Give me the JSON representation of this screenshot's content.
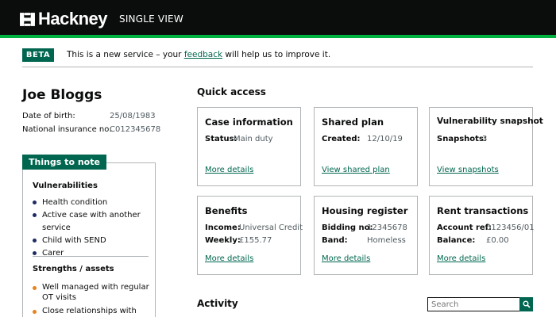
{
  "header": {
    "logo_text": "Hackney",
    "service_name": "SINGLE VIEW"
  },
  "beta_banner": {
    "tag": "BETA",
    "text_before": "This is a new service – your ",
    "link_text": "feedback",
    "text_after": " will help us to improve it."
  },
  "person": {
    "name": "Joe Bloggs",
    "details": [
      {
        "label": "Date of birth:",
        "value": "25/08/1983"
      },
      {
        "label": "National insurance no:",
        "value": "C012345678"
      }
    ]
  },
  "things_to_note": {
    "title": "Things to note",
    "vulnerabilities_heading": "Vulnerabilities",
    "vulnerabilities": [
      "Health condition",
      "Active case with another service",
      "Child with SEND",
      "Carer"
    ],
    "strengths_heading": "Strengths / assets",
    "strengths": [
      "Well managed with regular OT visits",
      "Close relationships with"
    ]
  },
  "quick_access": {
    "title": "Quick access",
    "cards": [
      {
        "title": "Case information",
        "rows": [
          {
            "label": "Status:",
            "value": "Main duty"
          }
        ],
        "link": "More details"
      },
      {
        "title": "Shared plan",
        "rows": [
          {
            "label": "Created:",
            "value": "12/10/19"
          }
        ],
        "link": "View shared plan"
      },
      {
        "title": "Vulnerability snapshot",
        "rows": [
          {
            "label": "Snapshots:",
            "value": "3"
          }
        ],
        "link": "View snapshots"
      },
      {
        "title": "Benefits",
        "rows": [
          {
            "label": "Income:",
            "value": "Universal Credit"
          },
          {
            "label": "Weekly:",
            "value": "£155.77"
          }
        ],
        "link": "More details"
      },
      {
        "title": "Housing register",
        "rows": [
          {
            "label": "Bidding no:",
            "value": "12345678"
          },
          {
            "label": "Band:",
            "value": "Homeless"
          }
        ],
        "link": "More details"
      },
      {
        "title": "Rent transactions",
        "rows": [
          {
            "label": "Account ref:",
            "value": "0123456/01"
          },
          {
            "label": "Balance:",
            "value": "£0.00"
          }
        ],
        "link": "More details"
      }
    ]
  },
  "activity": {
    "title": "Activity",
    "search_placeholder": "Search"
  },
  "colors": {
    "header_bg": "#0b0c0c",
    "brand_green": "#00664f",
    "stripe_green": "#00b341",
    "bullet_navy": "#1d2b63",
    "bullet_orange": "#e8821d"
  },
  "icons": [
    "hackney-logo-icon",
    "search-icon"
  ]
}
